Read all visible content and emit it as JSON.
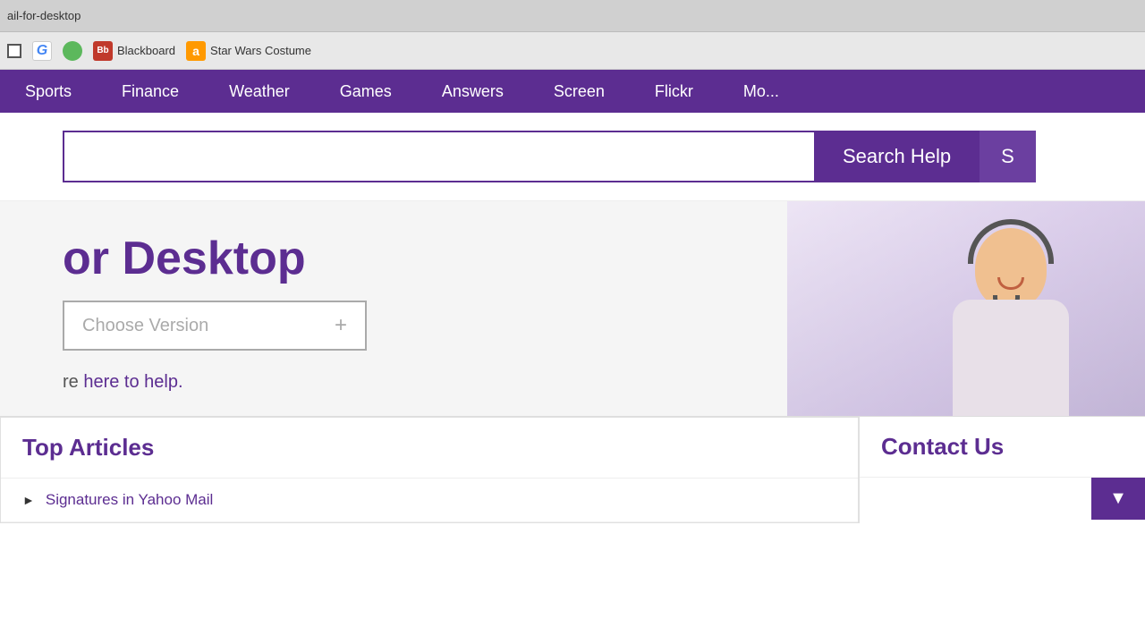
{
  "browser": {
    "tab_title_partial": "ail-for-desktop"
  },
  "bookmarks": {
    "items": [
      {
        "id": "checkbox",
        "type": "checkbox",
        "label": ""
      },
      {
        "id": "google",
        "type": "google",
        "label": "G"
      },
      {
        "id": "green",
        "type": "green",
        "label": ""
      },
      {
        "id": "blackboard",
        "type": "bb",
        "label": "Bb",
        "text": "Blackboard"
      },
      {
        "id": "amazon",
        "type": "amazon",
        "label": "a",
        "text": "Star Wars Costume"
      }
    ]
  },
  "nav": {
    "items": [
      {
        "id": "sports",
        "label": "Sports"
      },
      {
        "id": "finance",
        "label": "Finance"
      },
      {
        "id": "weather",
        "label": "Weather"
      },
      {
        "id": "games",
        "label": "Games"
      },
      {
        "id": "answers",
        "label": "Answers"
      },
      {
        "id": "screen",
        "label": "Screen"
      },
      {
        "id": "flickr",
        "label": "Flickr"
      },
      {
        "id": "more",
        "label": "Mo..."
      }
    ]
  },
  "search": {
    "input_placeholder": "",
    "input_value": "",
    "search_help_label": "Search Help",
    "search_extra_label": "S"
  },
  "hero": {
    "title_partial": "or Desktop",
    "choose_version_label": "Choose Version",
    "subtitle_partial": "re ",
    "help_link_label": "here to help."
  },
  "bottom": {
    "top_articles_label": "Top Articles",
    "contact_us_label": "Contact Us",
    "articles": [
      {
        "label": "Signatures in Yahoo Mail"
      }
    ]
  },
  "colors": {
    "purple": "#5c2d91",
    "purple_light": "#6b3fa0"
  }
}
